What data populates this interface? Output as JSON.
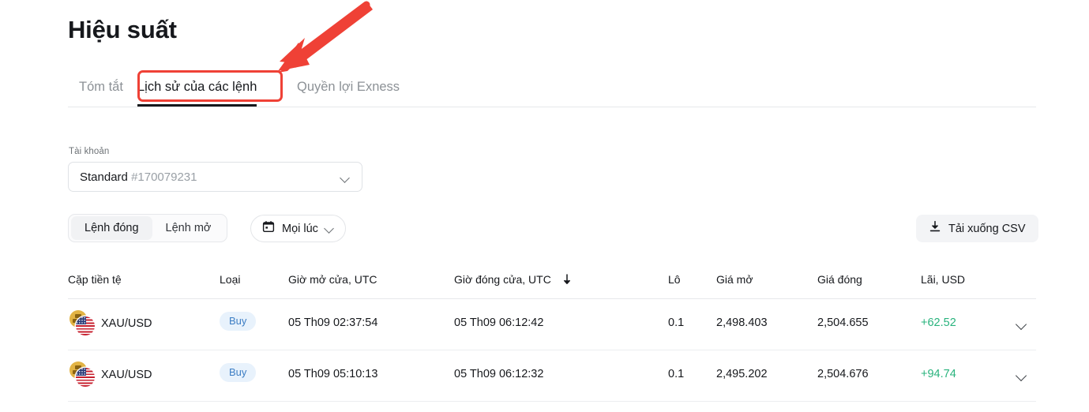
{
  "header": {
    "title": "Hiệu suất"
  },
  "tabs": [
    {
      "id": "summary",
      "label": "Tóm tắt",
      "active": false
    },
    {
      "id": "orders",
      "label": "Lịch sử của các lệnh",
      "active": true
    },
    {
      "id": "benefits",
      "label": "Quyền lợi Exness",
      "active": false
    }
  ],
  "account": {
    "label": "Tài khoản",
    "type": "Standard",
    "number": "#170079231",
    "chevron_icon": "chevron-down-icon"
  },
  "filters": {
    "segments": [
      {
        "id": "closed",
        "label": "Lệnh đóng",
        "active": true
      },
      {
        "id": "open",
        "label": "Lệnh mở",
        "active": false
      }
    ],
    "date": {
      "icon": "calendar-icon",
      "label": "Mọi lúc",
      "chevron_icon": "chevron-down-icon"
    },
    "download": {
      "icon": "download-icon",
      "label": "Tải xuống CSV"
    }
  },
  "table": {
    "columns": {
      "pair": "Cặp tiền tệ",
      "type": "Loại",
      "open_time": "Giờ mở cửa, UTC",
      "close_time": "Giờ đóng cửa, UTC",
      "lot": "Lô",
      "open_price": "Giá mở",
      "close_price": "Giá đóng",
      "profit": "Lãi, USD"
    },
    "sort": {
      "column": "close_time",
      "icon": "sort-down-arrow-icon",
      "glyph": "↓"
    },
    "rows": [
      {
        "pair": "XAU/USD",
        "pair_icon": "gold-usd-pair-icon",
        "type": "Buy",
        "open_time": "05 Th09 02:37:54",
        "close_time": "05 Th09 06:12:42",
        "lot": "0.1",
        "open_price": "2,498.403",
        "close_price": "2,504.655",
        "profit": "+62.52",
        "expand_icon": "chevron-down-icon"
      },
      {
        "pair": "XAU/USD",
        "pair_icon": "gold-usd-pair-icon",
        "type": "Buy",
        "open_time": "05 Th09 05:10:13",
        "close_time": "05 Th09 06:12:32",
        "lot": "0.1",
        "open_price": "2,495.202",
        "close_price": "2,504.676",
        "profit": "+94.74",
        "expand_icon": "chevron-down-icon"
      }
    ]
  },
  "annotations": {
    "highlight_color": "#ef4136",
    "arrow_icon": "red-arrow-pointing-down-left",
    "rect_target": "Lịch sử của các lệnh"
  },
  "colors": {
    "profit_green": "#29b37d",
    "badge_buy_bg": "#e8f2fc",
    "badge_buy_text": "#3d7ec4",
    "accent_red": "#ef4136"
  }
}
